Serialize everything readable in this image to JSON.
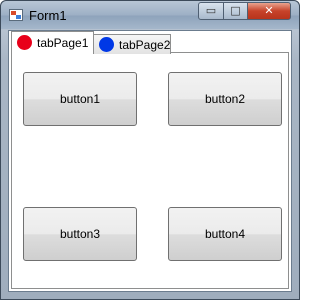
{
  "window": {
    "title": "Form1",
    "controls": {
      "minimize": "▭",
      "maximize": "□",
      "close": "✕"
    }
  },
  "tabs": [
    {
      "label": "tabPage1",
      "dot_color": "#e8001a",
      "selected": true
    },
    {
      "label": "tabPage2",
      "dot_color": "#0038e6",
      "selected": false
    }
  ],
  "buttons": [
    {
      "label": "button1"
    },
    {
      "label": "button2"
    },
    {
      "label": "button3"
    },
    {
      "label": "button4"
    }
  ]
}
